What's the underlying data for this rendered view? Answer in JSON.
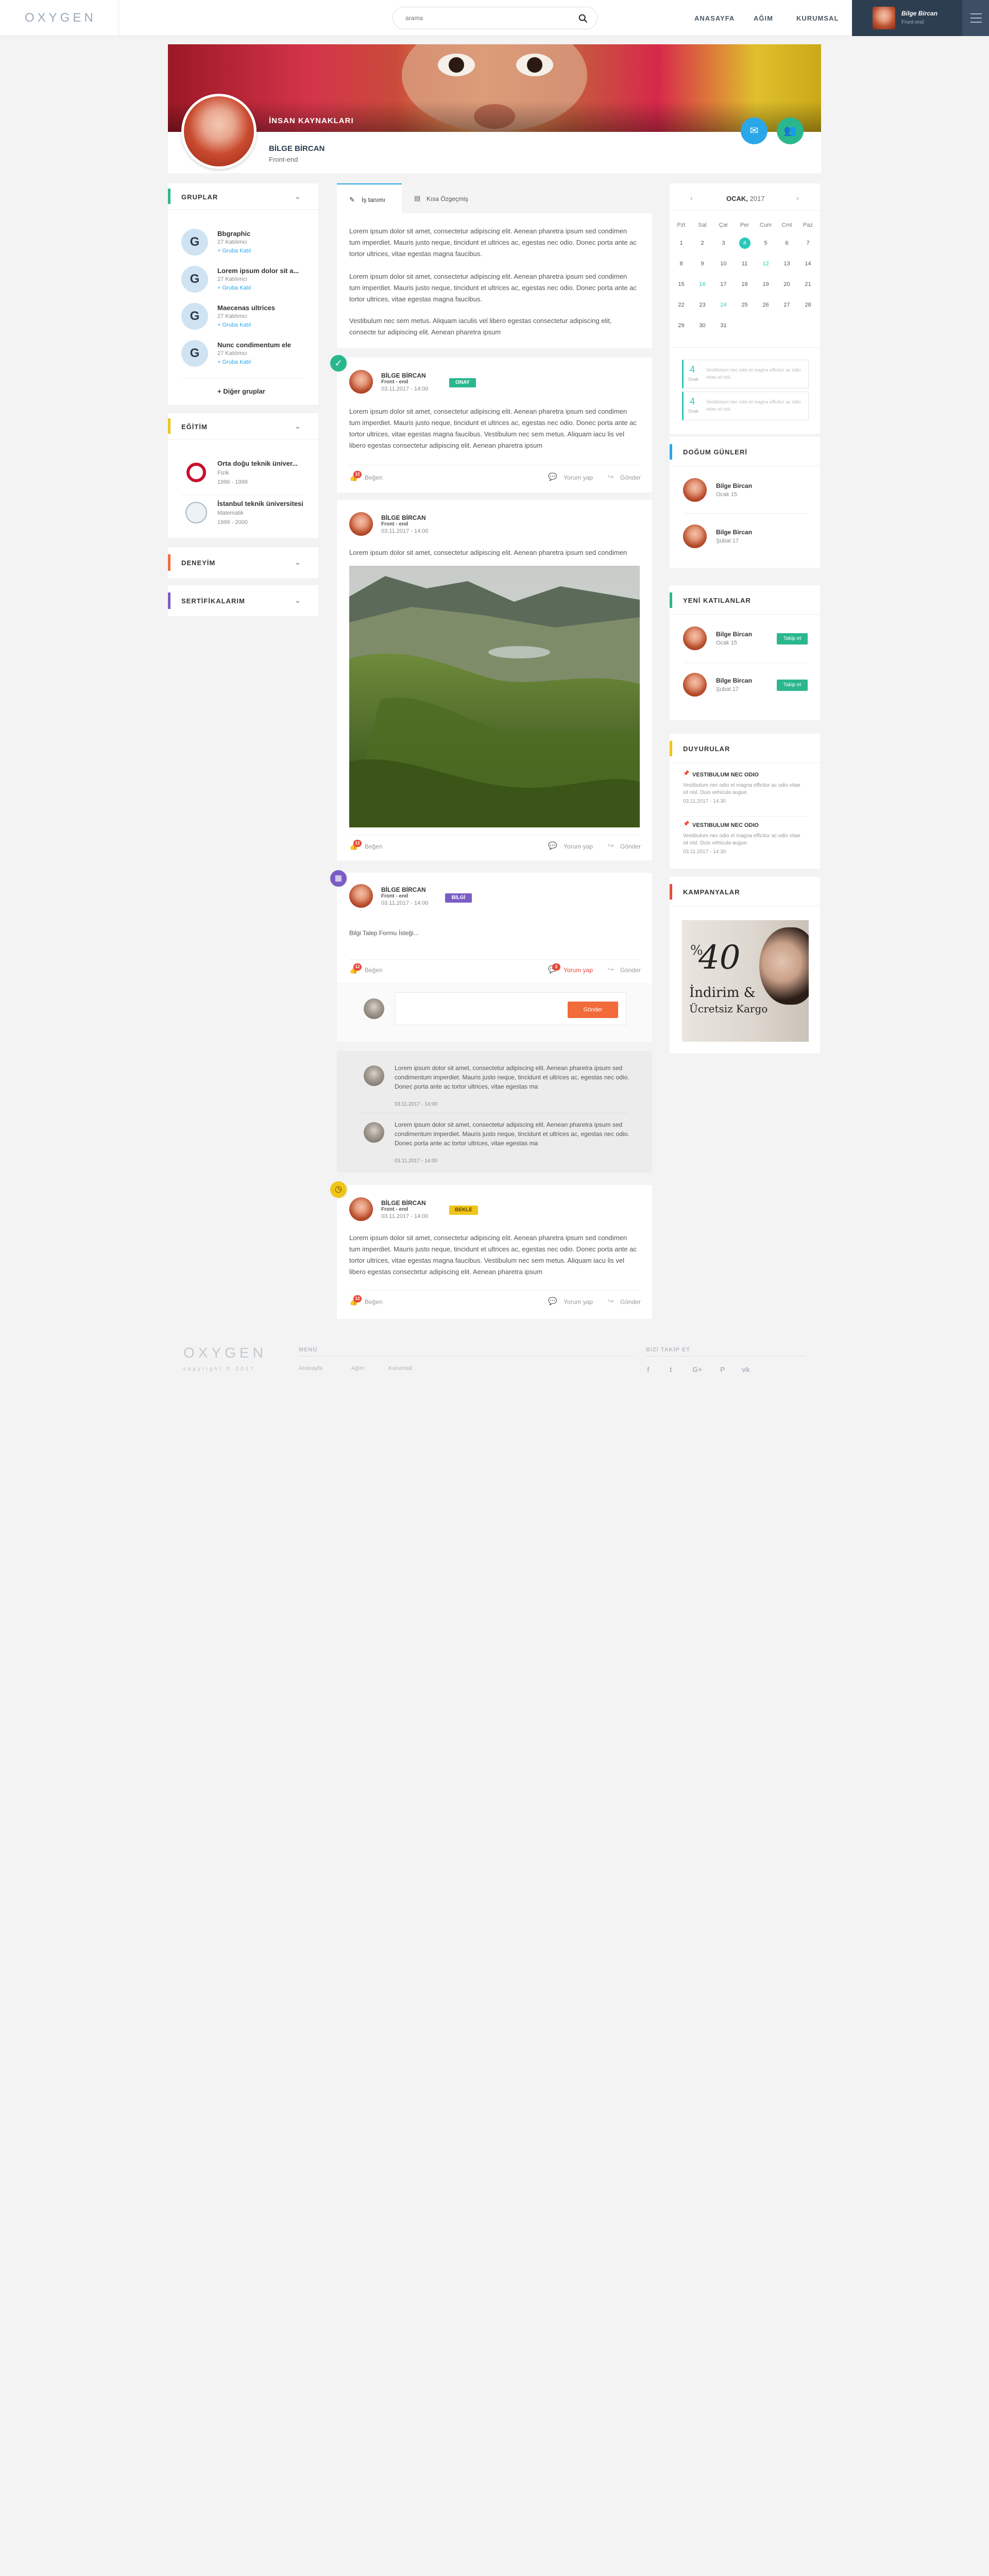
{
  "header": {
    "logo": "OXYGEN",
    "search_placeholder": "arama",
    "nav": [
      "ANASAYFA",
      "AĞIM",
      "KURUMSAL"
    ],
    "user_name": "Bilge Bircan",
    "user_role": "Front-end"
  },
  "profile": {
    "department": "İNSAN KAYNAKLARI",
    "name": "BİLGE BİRCAN",
    "title": "Front-end"
  },
  "groups": {
    "title": "GRUPLAR",
    "items": [
      {
        "name": "Bbgraphic",
        "count": "27 Katılımcı",
        "join": "+ Gruba Katıl"
      },
      {
        "name": "Lorem ipsum dolor sit a...",
        "count": "27 Katılımcı",
        "join": "+ Gruba Katıl"
      },
      {
        "name": "Maecenas ultrices",
        "count": "27 Katılımcı",
        "join": "+ Gruba Katıl"
      },
      {
        "name": "Nunc condimentum ele",
        "count": "27 Katılımcı",
        "join": "+ Gruba Katıl"
      }
    ],
    "more": "+ Diğer gruplar"
  },
  "education": {
    "title": "EĞİTİM",
    "items": [
      {
        "name": "Orta doğu teknik üniver...",
        "field": "Fizik",
        "years": "1996 - 1999"
      },
      {
        "name": "İstanbul teknik üniversitesi",
        "field": "Matematik",
        "years": "1999 - 2000"
      }
    ]
  },
  "experience": {
    "title": "DENEYİM"
  },
  "certificates": {
    "title": "SERTİFİKALARIM"
  },
  "tabs": {
    "job": "İş tanımı",
    "cv": "Kısa Özgeçmiş"
  },
  "about": {
    "p1": "Lorem ipsum dolor sit amet, consectetur adipiscing elit. Aenean pharetra ipsum sed condimen tum imperdiet. Mauris justo neque, tincidunt et ultrices ac, egestas nec odio. Donec porta ante ac tortor ultrices, vitae egestas magna faucibus.",
    "p2": "Lorem ipsum dolor sit amet, consectetur adipiscing elit. Aenean pharetra ipsum sed condimen tum imperdiet. Mauris justo neque, tincidunt et ultrices ac, egestas nec odio. Donec porta ante ac tortor ultrices, vitae egestas magna faucibus.",
    "p3": "Vestibulum nec sem metus. Aliquam iaculis vel libero egestas consectetur adipiscing elit, consecte tur adipiscing elit. Aenean pharetra ipsum"
  },
  "posts": [
    {
      "name": "BİLGE BİRCAN",
      "role": "Front - end",
      "date": "03.11.2017 - 14:00",
      "badge": "ONAY",
      "text": "Lorem ipsum dolor sit amet, consectetur adipiscing elit. Aenean pharetra ipsum sed condimen tum imperdiet. Mauris justo neque, tincidunt et ultrices ac, egestas nec odio. Donec porta ante ac tortor ultrices, vitae egestas magna faucibus. Vestibulum nec sem metus. Aliquam iacu lis vel libero egestas consectetur adipiscing elit. Aenean pharetra ipsum",
      "likes": "12",
      "like": "Beğen",
      "comment": "Yorum yap",
      "share": "Gönder"
    },
    {
      "name": "BİLGE BİRCAN",
      "role": "Front - end",
      "date": "03.11.2017 - 14:00",
      "text": "Lorem ipsum dolor sit amet, consectetur adipiscing elit. Aenean pharetra ipsum sed condimen",
      "likes": "12",
      "like": "Beğen",
      "comment": "Yorum yap",
      "share": "Gönder"
    },
    {
      "name": "BİLGE BİRCAN",
      "role": "Front - end",
      "date": "03.11.2017 - 14:00",
      "badge": "BİLGİ",
      "text": "Bilgi Talep Formu İsteği...",
      "likes": "12",
      "comments": "2",
      "like": "Beğen",
      "comment": "Yorum yap",
      "share": "Gönder",
      "send": "Gönder",
      "replies": [
        {
          "text": "Lorem ipsum dolor sit amet, consectetur adipiscing elit. Aenean pharetra ipsum sed condimentum imperdiet. Mauris justo neque, tincidunt et ultrices ac, egestas nec odio. Donec porta ante ac tortor ultrices, vitae egestas ma",
          "date": "03.11.2017 - 14:00"
        },
        {
          "text": "Lorem ipsum dolor sit amet, consectetur adipiscing elit. Aenean pharetra ipsum sed condimentum imperdiet. Mauris justo neque, tincidunt et ultrices ac, egestas nec odio. Donec porta ante ac tortor ultrices, vitae egestas ma",
          "date": "03.11.2017 - 14:00"
        }
      ]
    },
    {
      "name": "BİLGE BİRCAN",
      "role": "Front - end",
      "date": "03.11.2017 - 14:00",
      "badge": "BEKLE",
      "text": "Lorem ipsum dolor sit amet, consectetur adipiscing elit. Aenean pharetra ipsum sed condimen tum imperdiet. Mauris justo neque, tincidunt et ultrices ac, egestas nec odio. Donec porta ante ac tortor ultrices, vitae egestas magna faucibus. Vestibulum nec sem metus. Aliquam iacu lis vel libero egestas consectetur adipiscing elit. Aenean pharetra ipsum",
      "likes": "12",
      "like": "Beğen",
      "comment": "Yorum yap",
      "share": "Gönder"
    }
  ],
  "calendar": {
    "month": "OCAK,",
    "year": "2017",
    "days": [
      "Pzt",
      "Sal",
      "Çar",
      "Per",
      "Cum",
      "Cmt",
      "Paz"
    ],
    "weeks": [
      [
        "1",
        "2",
        "3",
        "4",
        "5",
        "6",
        "7"
      ],
      [
        "8",
        "9",
        "10",
        "11",
        "12",
        "13",
        "14"
      ],
      [
        "15",
        "16",
        "17",
        "18",
        "19",
        "20",
        "21"
      ],
      [
        "22",
        "23",
        "24",
        "25",
        "26",
        "27",
        "28"
      ],
      [
        "29",
        "30",
        "31",
        "",
        "",
        "",
        "",
        ""
      ]
    ],
    "events": [
      {
        "day": "4",
        "month": "Ocak",
        "text": "Vestibulum nec odio et magna efficitur ac odio vitae sit nisl."
      },
      {
        "day": "4",
        "month": "Ocak",
        "text": "Vestibulum nec odio et magna efficitur ac odio vitae sit nisl."
      }
    ]
  },
  "birthdays": {
    "title": "DOĞUM GÜNLERİ",
    "items": [
      {
        "name": "Bilge Bircan",
        "date": "Ocak 15"
      },
      {
        "name": "Bilge Bircan",
        "date": "Şubat 17"
      }
    ]
  },
  "newcomers": {
    "title": "YENİ KATILANLAR",
    "items": [
      {
        "name": "Bilge Bircan",
        "date": "Ocak 15",
        "btn": "Takip et"
      },
      {
        "name": "Bilge Bircan",
        "date": "Şubat 17",
        "btn": "Takip et"
      }
    ]
  },
  "announcements": {
    "title": "DUYURULAR",
    "items": [
      {
        "title": "VESTIBULUM NEC ODIO",
        "text": "Vestibulum nec odio et magna efficitur ac odio vitae sit nisl. Duis vehicula augue.",
        "date": "03.11.2017 - 14:30"
      },
      {
        "title": "VESTIBULUM NEC ODIO",
        "text": "Vestibulum nec odio et magna efficitur ac odio vitae sit nisl. Duis vehicula augue.",
        "date": "03.11.2017 - 14:30"
      }
    ]
  },
  "campaigns": {
    "title": "KAMPANYALAR",
    "percent": "%",
    "number": "40",
    "line1": "İndirim &",
    "line2": "Ücretsiz Kargo"
  },
  "footer": {
    "logo": "OXYGEN",
    "copyright": "copyright © 2017",
    "menu_title": "MENÜ",
    "menu": [
      "Anasayfa",
      "Ağım",
      "Kurumsal"
    ],
    "follow_title": "BİZİ TAKİP ET",
    "social": [
      "f",
      "t",
      "G+",
      "P",
      "vk"
    ]
  },
  "colors": {
    "green": "#2bb78e",
    "purple": "#7b5cc6",
    "yellow": "#f0c419",
    "orange": "#f26b3a",
    "red": "#e74c3c",
    "blue": "#2aa7e8",
    "navy": "#2e3e51"
  }
}
